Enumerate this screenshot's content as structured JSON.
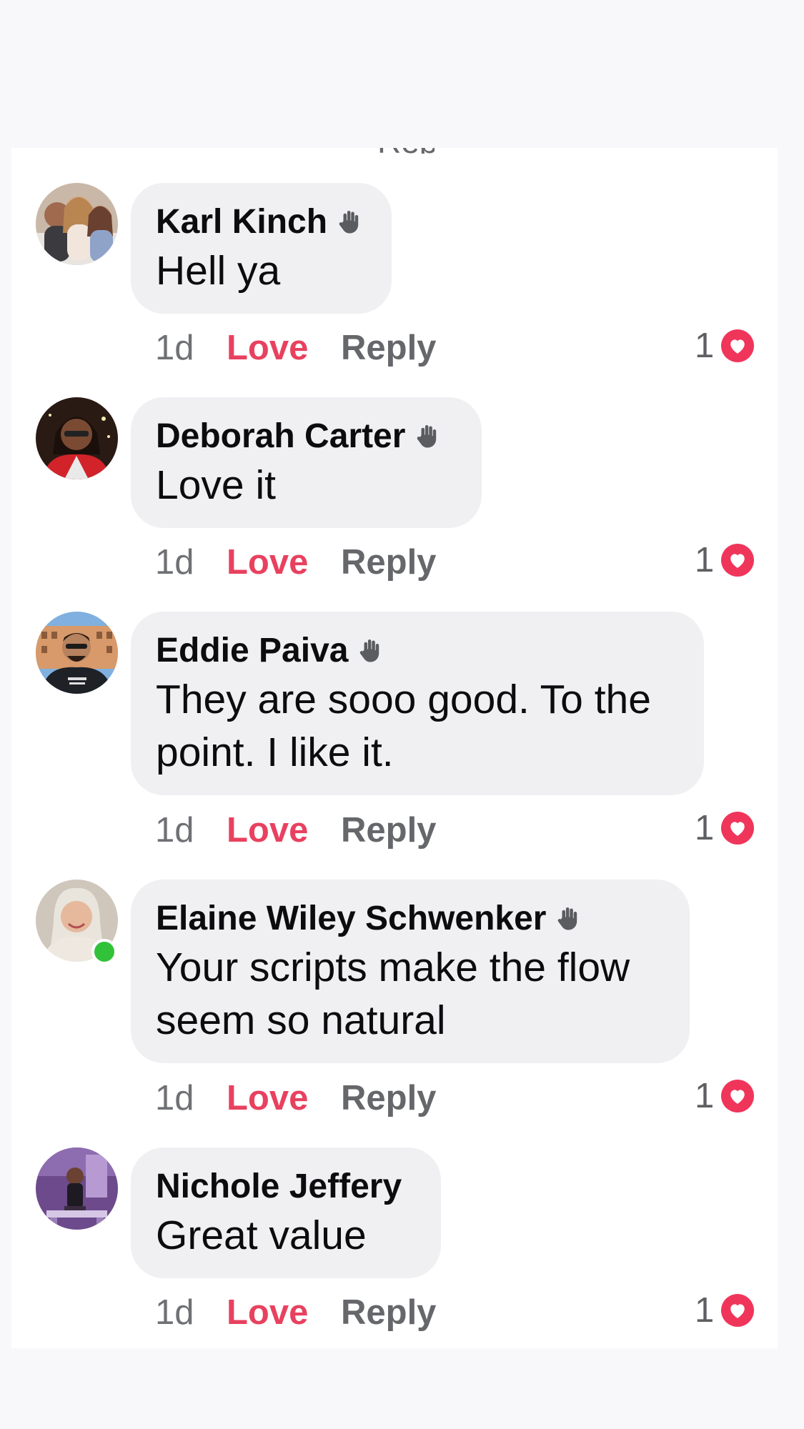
{
  "comments": [
    {
      "author": "Karl Kinch",
      "text": "Hell ya",
      "time": "1d",
      "love_label": "Love",
      "reply_label": "Reply",
      "reaction_count": "1",
      "has_wave_badge": true,
      "online": false
    },
    {
      "author": "Deborah Carter",
      "text": "Love it",
      "time": "1d",
      "love_label": "Love",
      "reply_label": "Reply",
      "reaction_count": "1",
      "has_wave_badge": true,
      "online": false
    },
    {
      "author": "Eddie Paiva",
      "text": "They are sooo good. To the point. I like it.",
      "time": "1d",
      "love_label": "Love",
      "reply_label": "Reply",
      "reaction_count": "1",
      "has_wave_badge": true,
      "online": false
    },
    {
      "author": "Elaine Wiley Schwenker",
      "text": "Your scripts make the flow seem so natural",
      "time": "1d",
      "love_label": "Love",
      "reply_label": "Reply",
      "reaction_count": "1",
      "has_wave_badge": true,
      "online": true
    },
    {
      "author": "Nichole Jeffery",
      "text": "Great value",
      "time": "1d",
      "love_label": "Love",
      "reply_label": "Reply",
      "reaction_count": "1",
      "has_wave_badge": false,
      "online": false
    }
  ],
  "colors": {
    "love": "#e8415f",
    "heart_badge": "#f0355b",
    "bubble": "#f0f0f3",
    "online": "#31c23a"
  },
  "icons": {
    "wave": "waving-hand-icon",
    "reaction": "heart-icon"
  }
}
